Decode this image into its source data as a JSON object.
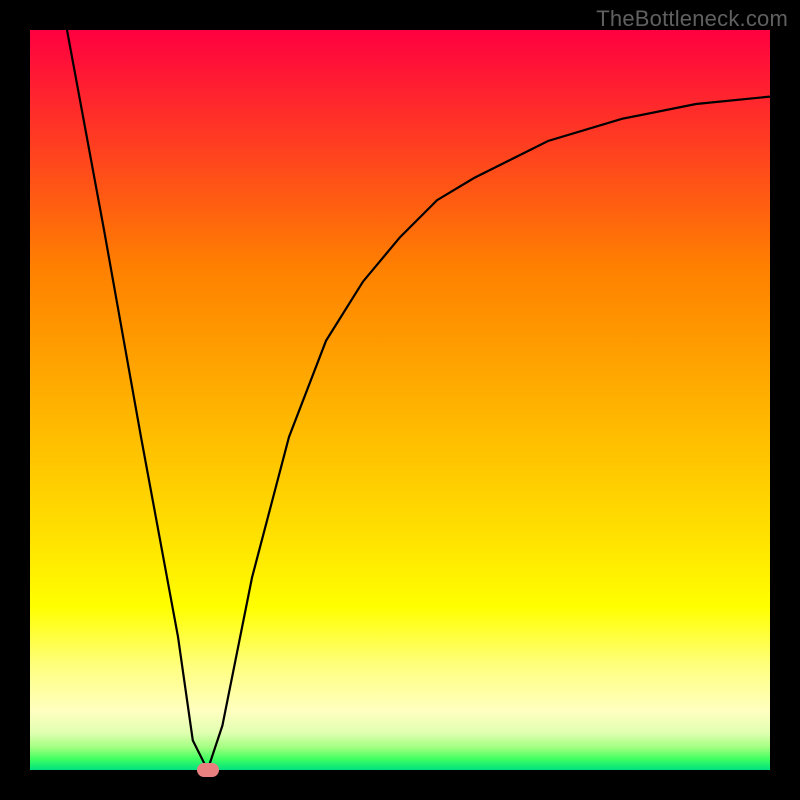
{
  "watermark": "TheBottleneck.com",
  "chart_data": {
    "type": "line",
    "title": "",
    "xlabel": "",
    "ylabel": "",
    "xlim": [
      0,
      100
    ],
    "ylim": [
      0,
      100
    ],
    "grid": false,
    "series": [
      {
        "name": "bottleneck-curve",
        "x": [
          5,
          10,
          15,
          20,
          22,
          24,
          26,
          30,
          35,
          40,
          45,
          50,
          55,
          60,
          70,
          80,
          90,
          100
        ],
        "values": [
          100,
          73,
          45,
          18,
          4,
          0,
          6,
          26,
          45,
          58,
          66,
          72,
          77,
          80,
          85,
          88,
          90,
          91
        ]
      }
    ],
    "annotations": [
      {
        "name": "optimal-point",
        "x": 24,
        "y": 0,
        "shape": "pill",
        "color": "#e98080"
      }
    ],
    "background_gradient": {
      "direction": "vertical",
      "top_color": "#ff0040",
      "bottom_color": "#00e080",
      "meaning": "top=high bottleneck, bottom=low bottleneck"
    }
  }
}
